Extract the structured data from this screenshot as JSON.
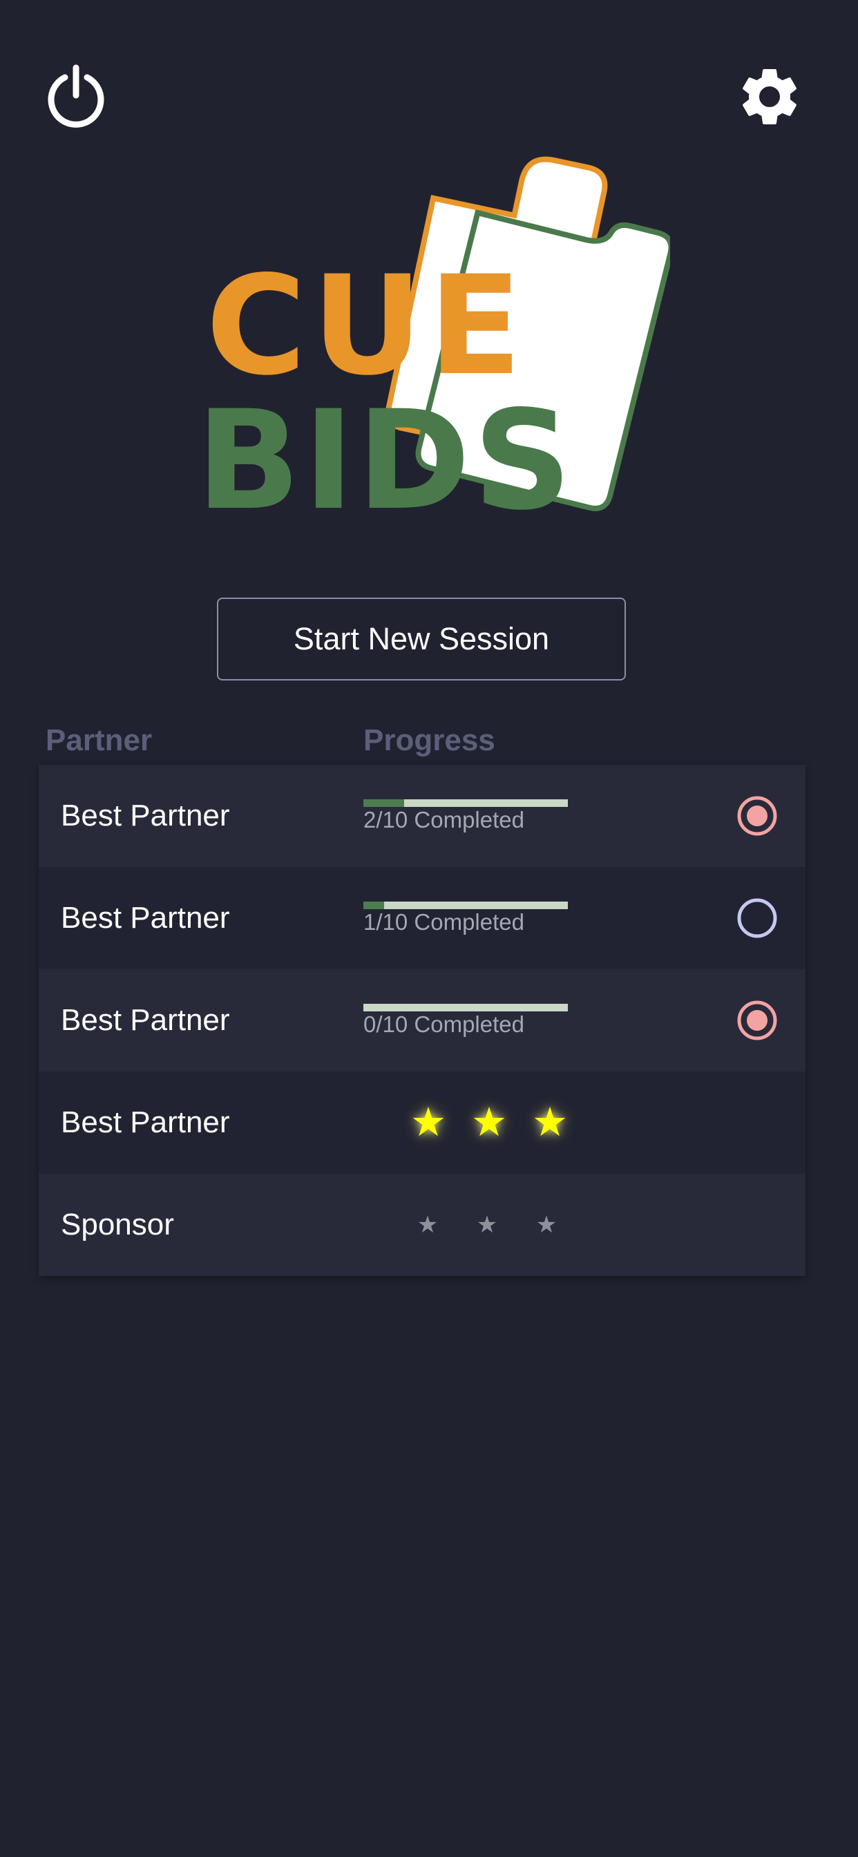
{
  "header": {
    "power_icon": "power-icon",
    "settings_icon": "gear-icon"
  },
  "logo": {
    "line1": "CUE",
    "line2": "BIDS",
    "colors": {
      "orange": "#e8962a",
      "green": "#4a7a4b"
    }
  },
  "start_button": {
    "label": "Start New Session"
  },
  "table": {
    "headers": {
      "partner": "Partner",
      "progress": "Progress"
    },
    "rows": [
      {
        "name": "Best Partner",
        "progress_text": "2/10 Completed",
        "progress": 0.2,
        "radio": "selected"
      },
      {
        "name": "Best Partner",
        "progress_text": "1/10 Completed",
        "progress": 0.1,
        "radio": "unselected"
      },
      {
        "name": "Best Partner",
        "progress_text": "0/10 Completed",
        "progress": 0.0,
        "radio": "selected"
      },
      {
        "name": "Best Partner",
        "stars": 3,
        "star_style": "gold"
      },
      {
        "name": "Sponsor",
        "stars": 3,
        "star_style": "grey"
      }
    ]
  },
  "colors": {
    "background": "#212230",
    "row_alt": "#282a3a",
    "header_text": "#5b5f7a",
    "progress_fill": "#4d7d4f",
    "progress_track": "#c9d8c7",
    "radio_selected": "#f4a3a3",
    "radio_unselected": "#c5c8f0",
    "star_gold": "#ffff00"
  }
}
